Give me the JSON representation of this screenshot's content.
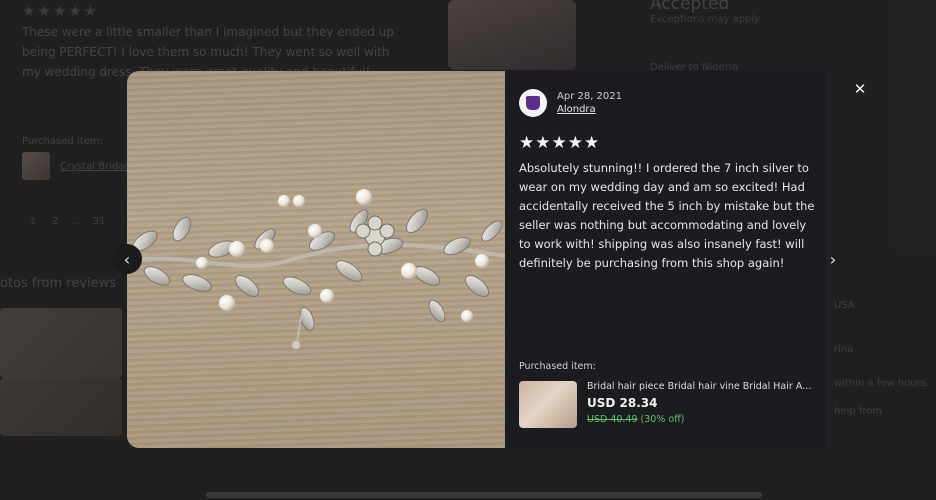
{
  "background": {
    "stars": "★★★★★",
    "review_text": "These were a little smaller than I imagined but they ended up being PERFECT! I love them so much! They went so well with my wedding dress. They were great quality and beautiful!",
    "accepted": "Accepted",
    "exceptions": "Exceptions may apply",
    "deliver_to": "Deliver to Nigeria",
    "purchased_label": "Purchased item:",
    "purchased_link": "Crystal Bridal...",
    "pagination": [
      "1",
      "2",
      "...",
      "31"
    ],
    "photos_title": "otos from reviews",
    "right_items": [
      "USA",
      "rina",
      "within a few hours.",
      "help from"
    ]
  },
  "review": {
    "date": "Apr 28, 2021",
    "reviewer": "Alondra",
    "stars": "★★★★★",
    "text": "Absolutely stunning!! I ordered the 7 inch silver to wear on my wedding day and am so excited! Had accidentally received the 5 inch by mistake but the seller was nothing but accommodating and lovely to work with! shipping was also insanely fast! will definitely be purchasing from this shop again!"
  },
  "purchased_item": {
    "label": "Purchased item:",
    "title": "Bridal hair piece Bridal hair vine Bridal Hair Ac...",
    "price": "USD 28.34",
    "original_price": "USD 40.49",
    "discount": "(30% off)"
  },
  "controls": {
    "close": "✕",
    "prev": "‹",
    "next": "›"
  },
  "colors": {
    "panel_bg": "#1c1c20",
    "discount_green": "#5fbf6a",
    "avatar_purple": "#5a2c8c"
  }
}
